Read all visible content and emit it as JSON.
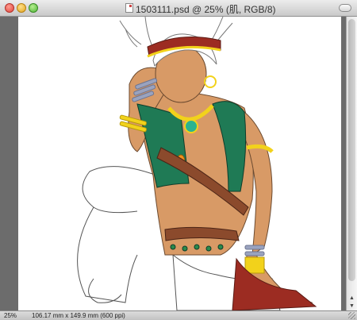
{
  "window": {
    "title": "1503111.psd @ 25% (肌, RGB/8)"
  },
  "statusbar": {
    "zoom": "25%",
    "doc_size": "106.17 mm x 149.9 mm (600 ppi)"
  },
  "colors": {
    "skin": "#d89a66",
    "vest": "#1f7a55",
    "gold": "#f2d21b",
    "headband": "#9c2c22",
    "bracelets": "#9aa3bf",
    "belt": "#8b4a2c"
  }
}
